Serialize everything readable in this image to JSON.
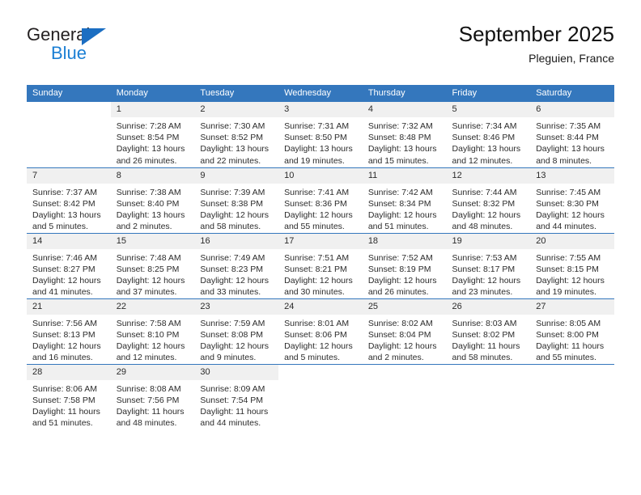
{
  "brand": {
    "name_top": "General",
    "name_bottom": "Blue",
    "accent_color": "#1b6ec2",
    "triangle_icon": "triangle-icon"
  },
  "header": {
    "title": "September 2025",
    "subtitle": "Pleguien, France"
  },
  "theme": {
    "header_blue": "#3477bd",
    "daynum_gray": "#f0f0f0",
    "text": "#2b2b2b"
  },
  "weekdays": [
    "Sunday",
    "Monday",
    "Tuesday",
    "Wednesday",
    "Thursday",
    "Friday",
    "Saturday"
  ],
  "weeks": [
    [
      {
        "day": "",
        "empty": true
      },
      {
        "day": "1",
        "sunrise": "Sunrise: 7:28 AM",
        "sunset": "Sunset: 8:54 PM",
        "daylight1": "Daylight: 13 hours",
        "daylight2": "and 26 minutes."
      },
      {
        "day": "2",
        "sunrise": "Sunrise: 7:30 AM",
        "sunset": "Sunset: 8:52 PM",
        "daylight1": "Daylight: 13 hours",
        "daylight2": "and 22 minutes."
      },
      {
        "day": "3",
        "sunrise": "Sunrise: 7:31 AM",
        "sunset": "Sunset: 8:50 PM",
        "daylight1": "Daylight: 13 hours",
        "daylight2": "and 19 minutes."
      },
      {
        "day": "4",
        "sunrise": "Sunrise: 7:32 AM",
        "sunset": "Sunset: 8:48 PM",
        "daylight1": "Daylight: 13 hours",
        "daylight2": "and 15 minutes."
      },
      {
        "day": "5",
        "sunrise": "Sunrise: 7:34 AM",
        "sunset": "Sunset: 8:46 PM",
        "daylight1": "Daylight: 13 hours",
        "daylight2": "and 12 minutes."
      },
      {
        "day": "6",
        "sunrise": "Sunrise: 7:35 AM",
        "sunset": "Sunset: 8:44 PM",
        "daylight1": "Daylight: 13 hours",
        "daylight2": "and 8 minutes."
      }
    ],
    [
      {
        "day": "7",
        "sunrise": "Sunrise: 7:37 AM",
        "sunset": "Sunset: 8:42 PM",
        "daylight1": "Daylight: 13 hours",
        "daylight2": "and 5 minutes."
      },
      {
        "day": "8",
        "sunrise": "Sunrise: 7:38 AM",
        "sunset": "Sunset: 8:40 PM",
        "daylight1": "Daylight: 13 hours",
        "daylight2": "and 2 minutes."
      },
      {
        "day": "9",
        "sunrise": "Sunrise: 7:39 AM",
        "sunset": "Sunset: 8:38 PM",
        "daylight1": "Daylight: 12 hours",
        "daylight2": "and 58 minutes."
      },
      {
        "day": "10",
        "sunrise": "Sunrise: 7:41 AM",
        "sunset": "Sunset: 8:36 PM",
        "daylight1": "Daylight: 12 hours",
        "daylight2": "and 55 minutes."
      },
      {
        "day": "11",
        "sunrise": "Sunrise: 7:42 AM",
        "sunset": "Sunset: 8:34 PM",
        "daylight1": "Daylight: 12 hours",
        "daylight2": "and 51 minutes."
      },
      {
        "day": "12",
        "sunrise": "Sunrise: 7:44 AM",
        "sunset": "Sunset: 8:32 PM",
        "daylight1": "Daylight: 12 hours",
        "daylight2": "and 48 minutes."
      },
      {
        "day": "13",
        "sunrise": "Sunrise: 7:45 AM",
        "sunset": "Sunset: 8:30 PM",
        "daylight1": "Daylight: 12 hours",
        "daylight2": "and 44 minutes."
      }
    ],
    [
      {
        "day": "14",
        "sunrise": "Sunrise: 7:46 AM",
        "sunset": "Sunset: 8:27 PM",
        "daylight1": "Daylight: 12 hours",
        "daylight2": "and 41 minutes."
      },
      {
        "day": "15",
        "sunrise": "Sunrise: 7:48 AM",
        "sunset": "Sunset: 8:25 PM",
        "daylight1": "Daylight: 12 hours",
        "daylight2": "and 37 minutes."
      },
      {
        "day": "16",
        "sunrise": "Sunrise: 7:49 AM",
        "sunset": "Sunset: 8:23 PM",
        "daylight1": "Daylight: 12 hours",
        "daylight2": "and 33 minutes."
      },
      {
        "day": "17",
        "sunrise": "Sunrise: 7:51 AM",
        "sunset": "Sunset: 8:21 PM",
        "daylight1": "Daylight: 12 hours",
        "daylight2": "and 30 minutes."
      },
      {
        "day": "18",
        "sunrise": "Sunrise: 7:52 AM",
        "sunset": "Sunset: 8:19 PM",
        "daylight1": "Daylight: 12 hours",
        "daylight2": "and 26 minutes."
      },
      {
        "day": "19",
        "sunrise": "Sunrise: 7:53 AM",
        "sunset": "Sunset: 8:17 PM",
        "daylight1": "Daylight: 12 hours",
        "daylight2": "and 23 minutes."
      },
      {
        "day": "20",
        "sunrise": "Sunrise: 7:55 AM",
        "sunset": "Sunset: 8:15 PM",
        "daylight1": "Daylight: 12 hours",
        "daylight2": "and 19 minutes."
      }
    ],
    [
      {
        "day": "21",
        "sunrise": "Sunrise: 7:56 AM",
        "sunset": "Sunset: 8:13 PM",
        "daylight1": "Daylight: 12 hours",
        "daylight2": "and 16 minutes."
      },
      {
        "day": "22",
        "sunrise": "Sunrise: 7:58 AM",
        "sunset": "Sunset: 8:10 PM",
        "daylight1": "Daylight: 12 hours",
        "daylight2": "and 12 minutes."
      },
      {
        "day": "23",
        "sunrise": "Sunrise: 7:59 AM",
        "sunset": "Sunset: 8:08 PM",
        "daylight1": "Daylight: 12 hours",
        "daylight2": "and 9 minutes."
      },
      {
        "day": "24",
        "sunrise": "Sunrise: 8:01 AM",
        "sunset": "Sunset: 8:06 PM",
        "daylight1": "Daylight: 12 hours",
        "daylight2": "and 5 minutes."
      },
      {
        "day": "25",
        "sunrise": "Sunrise: 8:02 AM",
        "sunset": "Sunset: 8:04 PM",
        "daylight1": "Daylight: 12 hours",
        "daylight2": "and 2 minutes."
      },
      {
        "day": "26",
        "sunrise": "Sunrise: 8:03 AM",
        "sunset": "Sunset: 8:02 PM",
        "daylight1": "Daylight: 11 hours",
        "daylight2": "and 58 minutes."
      },
      {
        "day": "27",
        "sunrise": "Sunrise: 8:05 AM",
        "sunset": "Sunset: 8:00 PM",
        "daylight1": "Daylight: 11 hours",
        "daylight2": "and 55 minutes."
      }
    ],
    [
      {
        "day": "28",
        "sunrise": "Sunrise: 8:06 AM",
        "sunset": "Sunset: 7:58 PM",
        "daylight1": "Daylight: 11 hours",
        "daylight2": "and 51 minutes."
      },
      {
        "day": "29",
        "sunrise": "Sunrise: 8:08 AM",
        "sunset": "Sunset: 7:56 PM",
        "daylight1": "Daylight: 11 hours",
        "daylight2": "and 48 minutes."
      },
      {
        "day": "30",
        "sunrise": "Sunrise: 8:09 AM",
        "sunset": "Sunset: 7:54 PM",
        "daylight1": "Daylight: 11 hours",
        "daylight2": "and 44 minutes."
      },
      {
        "day": "",
        "empty": true
      },
      {
        "day": "",
        "empty": true
      },
      {
        "day": "",
        "empty": true
      },
      {
        "day": "",
        "empty": true
      }
    ]
  ]
}
